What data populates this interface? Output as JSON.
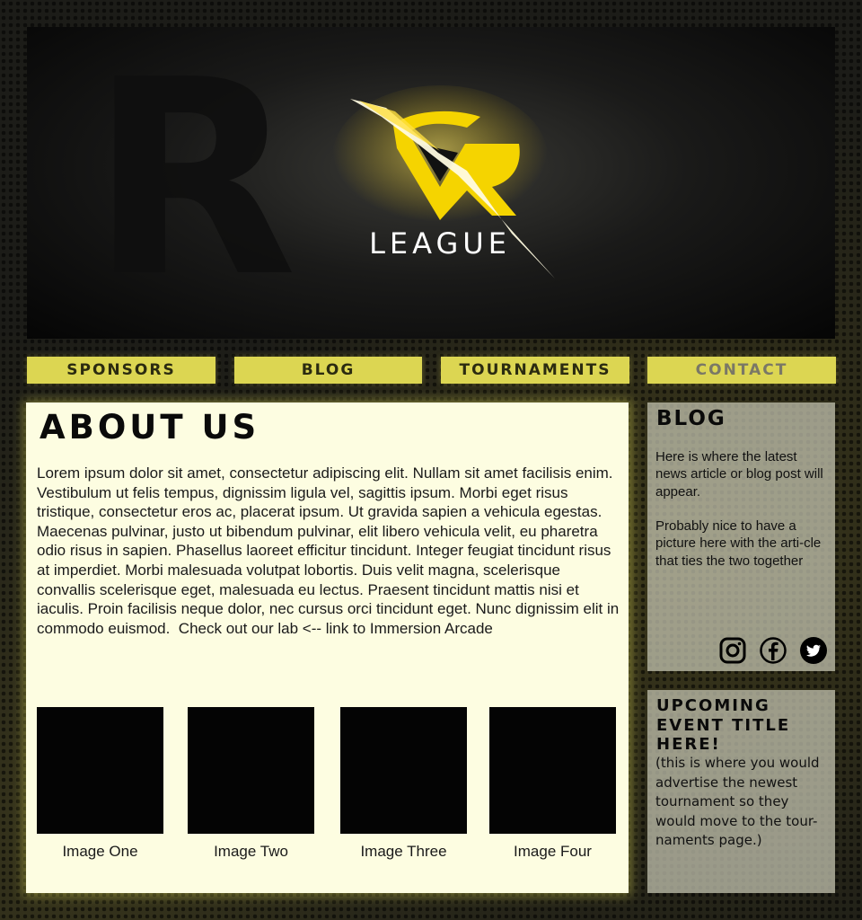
{
  "banner": {
    "logo_text": "LEAGUE",
    "background_letter": "R"
  },
  "nav": {
    "items": [
      {
        "label": "SPONSORS"
      },
      {
        "label": "BLOG"
      },
      {
        "label": "TOURNAMENTS"
      },
      {
        "label": "CONTACT"
      }
    ]
  },
  "about": {
    "title": "ABOUT US",
    "body": "Lorem ipsum dolor sit amet, consectetur adipiscing elit. Nullam sit amet facilisis enim. Vestibulum ut felis tempus, dignissim ligula vel, sagittis ipsum. Morbi eget risus tristique, consectetur eros ac, placerat ipsum. Ut gravida sapien a vehicula egestas. Maecenas pulvinar, justo ut bibendum pulvinar, elit libero vehicula velit, eu pharetra odio risus in sapien. Phasellus laoreet efficitur tincidunt. Integer feugiat tincidunt risus at imperdiet. Morbi malesuada volutpat lobortis. Duis velit magna, scelerisque convallis scelerisque eget, malesuada eu lectus. Praesent tincidunt mattis nisi et iaculis. Proin facilisis neque dolor, nec cursus orci tincidunt eget. Nunc dignissim elit in commodo euismod.",
    "link_text": "Check out our lab <-- link to Immersion Arcade",
    "images": [
      {
        "caption": "Image One"
      },
      {
        "caption": "Image Two"
      },
      {
        "caption": "Image Three"
      },
      {
        "caption": "Image Four"
      }
    ]
  },
  "blog": {
    "title": "BLOG",
    "paragraph1": "Here is where the latest news article or blog post will appear.",
    "paragraph2": "Probably nice to have a picture here with the arti-cle that ties the two together",
    "social": [
      "instagram-icon",
      "facebook-icon",
      "twitter-icon"
    ]
  },
  "event": {
    "title": "UPCOMING EVENT TITLE HERE!",
    "description": "(this is where you would advertise the newest tournament so they would move to the tour-naments page.)"
  },
  "colors": {
    "nav_bg": "#dcd652",
    "content_bg": "#fdfde1",
    "accent_glow": "#ffd400"
  }
}
